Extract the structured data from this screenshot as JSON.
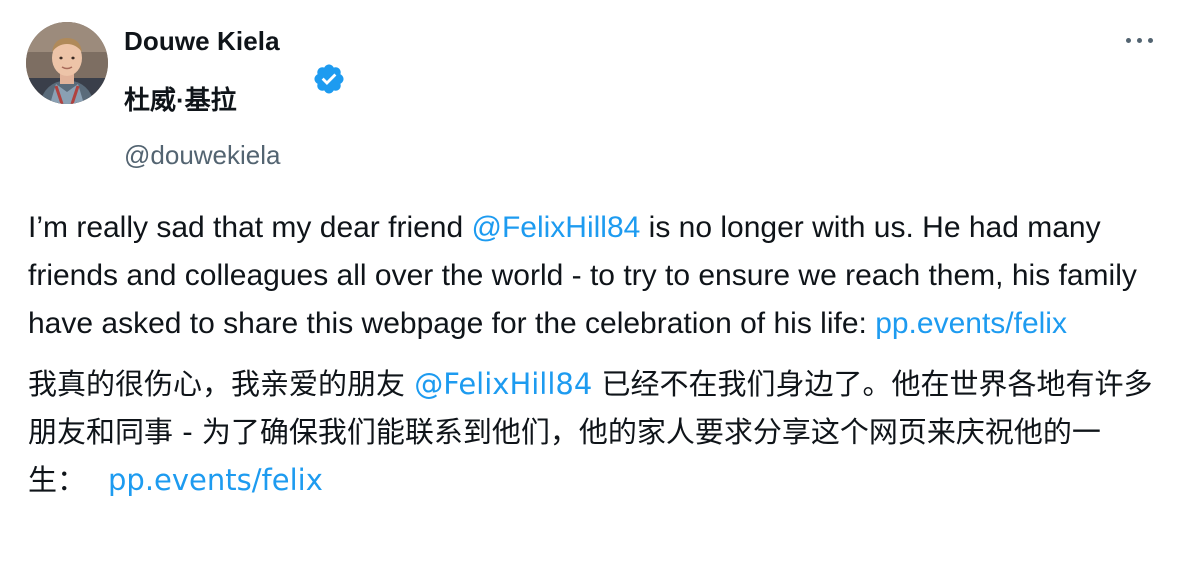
{
  "author": {
    "display_name": "Douwe Kiela",
    "display_name_cn": "杜威·基拉",
    "handle": "@douwekiela",
    "verified": true,
    "avatar_icon": "profile-photo",
    "verified_icon": "verified-badge-icon"
  },
  "menu": {
    "more_icon": "more-options-icon"
  },
  "tweet": {
    "en": {
      "text_1": "I’m really sad that my dear friend ",
      "mention": "@FelixHill84",
      "text_2": " is no longer with us. He had many friends and colleagues all over the world - to try to ensure we reach them, his family have asked to share this webpage for the celebration of his life: ",
      "link": "pp.events/felix"
    },
    "cn": {
      "text_1": "我真的很伤心，我亲爱的朋友 ",
      "mention": "@FelixHill84",
      "text_2": " 已经不在我们身边了。他在世界各地有许多朋友和同事 - 为了确保我们能联系到他们，他的家人要求分享这个网页来庆祝他的一生：",
      "link": "pp.events/felix"
    }
  },
  "colors": {
    "link": "#1d9bf0",
    "text": "#0f1419",
    "secondary": "#536471"
  }
}
